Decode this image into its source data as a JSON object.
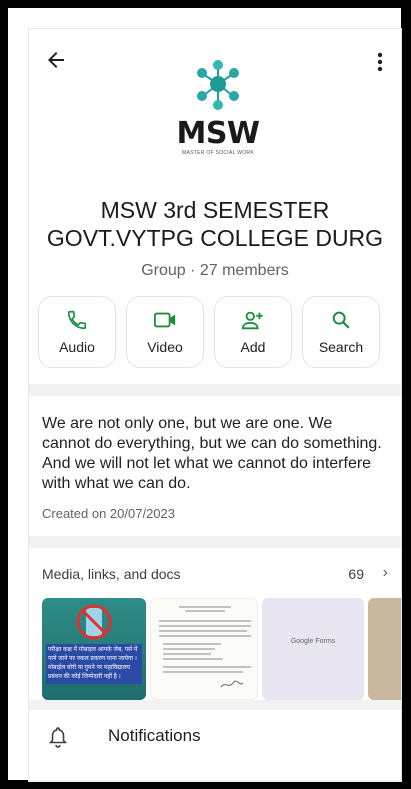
{
  "group": {
    "title_line1": "MSW 3rd SEMESTER",
    "title_line2": "GOVT.VYTPG COLLEGE DURG",
    "meta": "Group · 27 members",
    "logo_text": "MSW",
    "logo_subtext": "MASTER OF SOCIAL WORK"
  },
  "actions": [
    {
      "label": "Audio",
      "icon": "phone-icon"
    },
    {
      "label": "Video",
      "icon": "video-icon"
    },
    {
      "label": "Add",
      "icon": "add-person-icon"
    },
    {
      "label": "Search",
      "icon": "search-icon"
    }
  ],
  "about": {
    "text": "We are  not only one, but we are  one. We cannot do everything, but we can do something. And we will not let what we cannot do interfere with what we  can do.",
    "created": "Created on 20/07/2023"
  },
  "media": {
    "title": "Media, links, and docs",
    "count": "69",
    "thumb1_text": "परीक्षा कक्ष में मोबाइल आपके जेब, पर्स में पाये जाने पर नकल प्रकरण माना जायेगा । मोबाईल चोरी या गुमने पर महाविद्यालय प्रबंधन की कोई जिम्मेदारी नहीं है ।",
    "thumb3_text": "Google Forms"
  },
  "notifications": {
    "label": "Notifications"
  },
  "colors": {
    "accent": "#1e8e3e",
    "teal": "#18a3a0"
  }
}
